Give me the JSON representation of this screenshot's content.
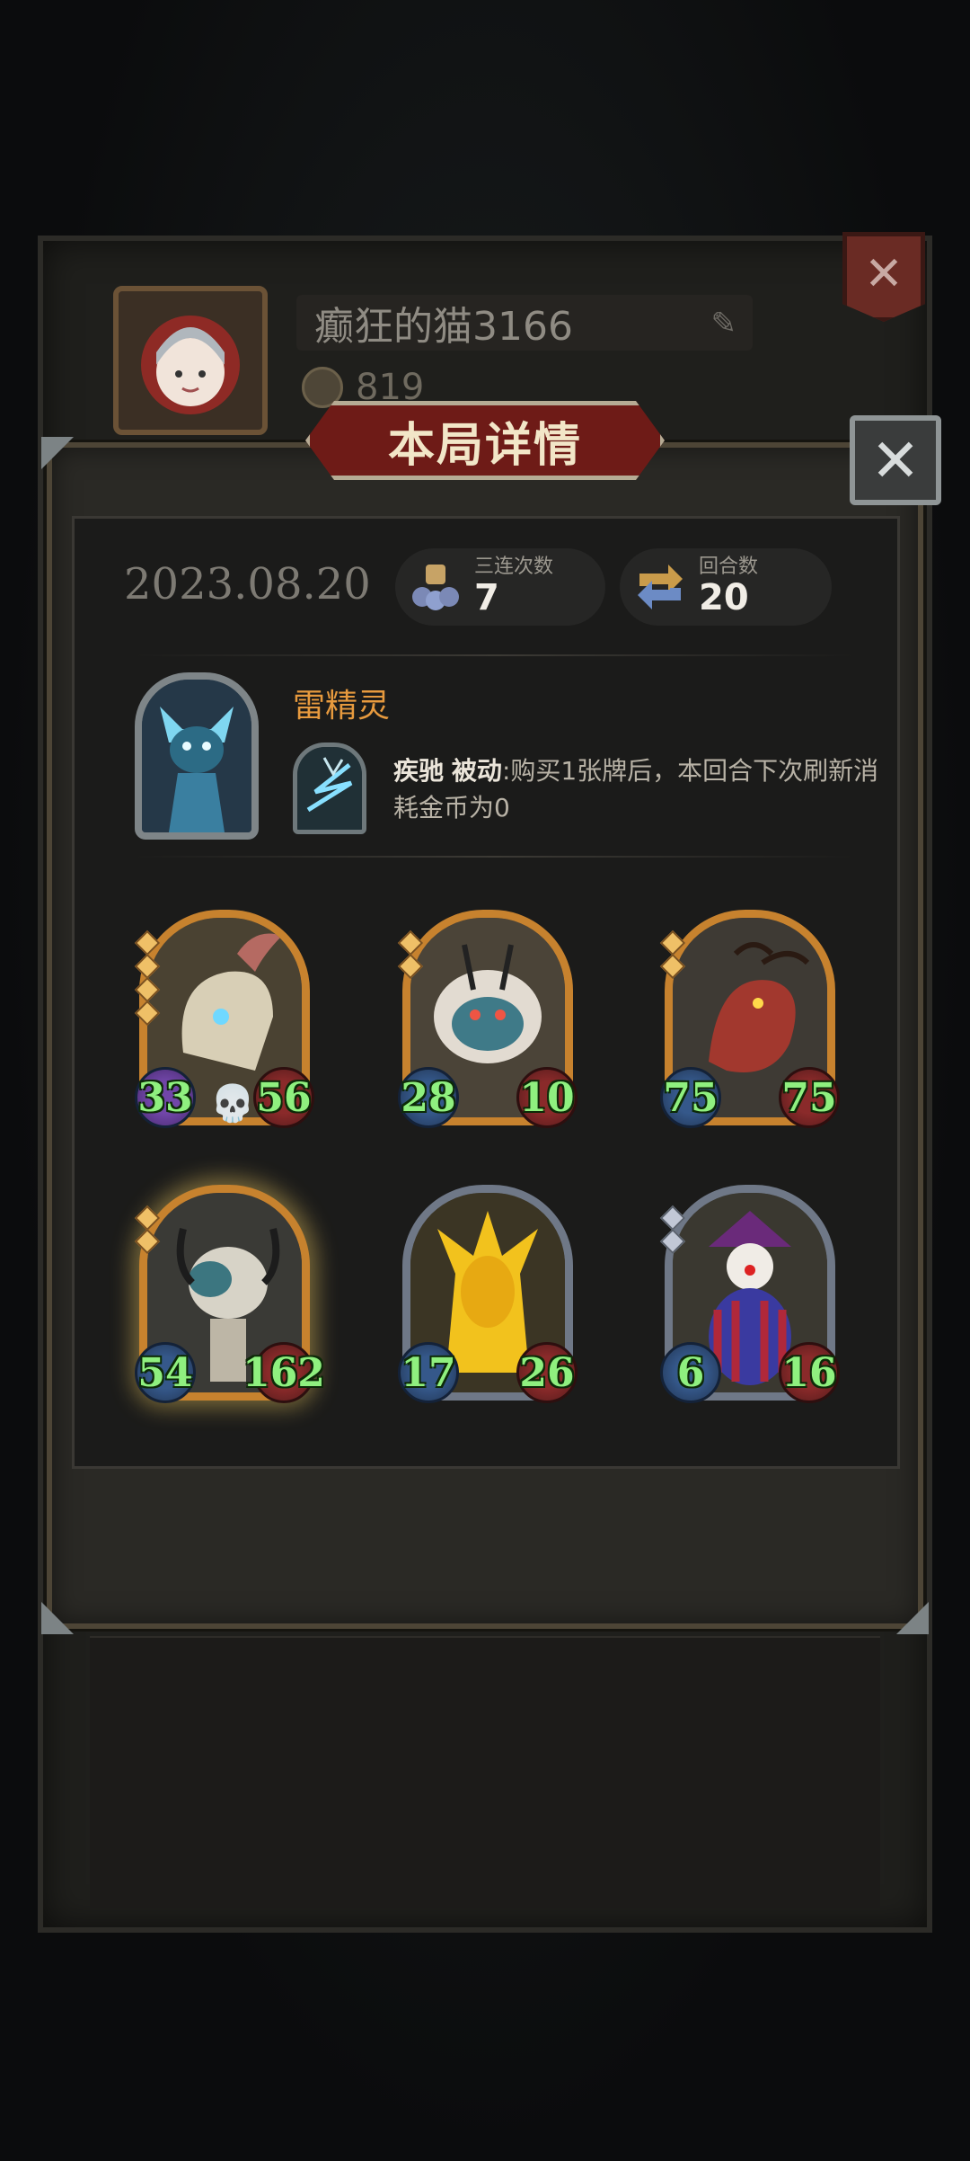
{
  "profile": {
    "player_name": "癫狂的猫3166",
    "coins": "819",
    "close_label": "✕",
    "edit_icon": "✎"
  },
  "modal": {
    "title": "本局详情",
    "close_label": "✕"
  },
  "summary": {
    "date": "2023.08.20",
    "triples_label": "三连次数",
    "triples_value": "7",
    "turns_label": "回合数",
    "turns_value": "20"
  },
  "hero": {
    "name": "雷精灵",
    "skill_name": "疾驰",
    "skill_type": "被动",
    "skill_desc": ":购买1张牌后，本回合下次刷新消耗金币为0"
  },
  "cards": [
    {
      "attack": "33",
      "health": "56",
      "frame": "gold",
      "tier": 4
    },
    {
      "attack": "28",
      "health": "10",
      "frame": "gold",
      "tier": 2
    },
    {
      "attack": "75",
      "health": "75",
      "frame": "gold",
      "tier": 2
    },
    {
      "attack": "54",
      "health": "162",
      "frame": "gold",
      "tier": 2
    },
    {
      "attack": "17",
      "health": "26",
      "frame": "silver",
      "tier": 0
    },
    {
      "attack": "6",
      "health": "16",
      "frame": "silver",
      "tier": 2
    }
  ],
  "colors": {
    "accent_red": "#6e1b17",
    "hero_name": "#e79a3e",
    "stat_green": "#8ff07f"
  }
}
